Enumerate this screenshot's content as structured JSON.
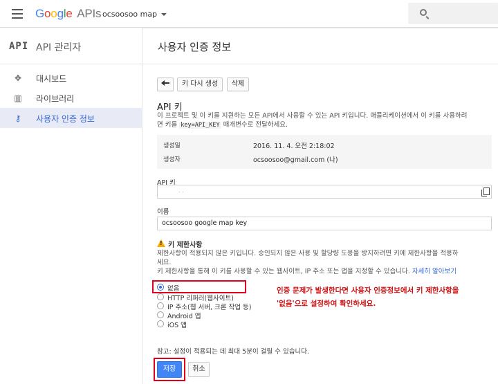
{
  "topbar": {
    "logo_google": [
      "G",
      "o",
      "o",
      "g",
      "l",
      "e"
    ],
    "logo_apis": "APIs",
    "project_name": "ocsoosoo map"
  },
  "sidebar": {
    "badge": "API",
    "title": "API 관리자",
    "items": [
      {
        "label": "대시보드",
        "icon": "dashboard-icon"
      },
      {
        "label": "라이브러리",
        "icon": "library-icon"
      },
      {
        "label": "사용자 인증 정보",
        "icon": "key-icon",
        "active": true
      }
    ]
  },
  "main": {
    "page_title": "사용자 인증 정보",
    "toolbar": {
      "regenerate_label": "키 다시 생성",
      "delete_label": "삭제"
    },
    "api_key_heading": "API 키",
    "description_line1": "이 프로젝트 및 이 키를 지원하는 모든 API에서 사용할 수 있는 API 키입니다. 애플리케이션에서 이 키를 사용하려",
    "description_line2_pre": "면 키를",
    "description_code": "key=API_KEY",
    "description_line2_post": "매개변수로 전달하세요.",
    "meta": {
      "created_label": "생성일",
      "created_value": "2016. 11. 4. 오전 2:18:02",
      "creator_label": "생성자",
      "creator_value": "ocsoosoo@gmail.com (나)"
    },
    "api_key_label": "API 키",
    "api_key_value": ".                    .",
    "name_label": "이름",
    "name_value": "ocsoosoo google map key",
    "restriction": {
      "title": "키 제한사항",
      "text_line1": "제한사항이 적용되지 않은 키입니다. 승인되지 않은 사용 및 할당량 도용을 방지하려면 키에 제한사항을 적용하",
      "text_line2": "세요.",
      "text_line3": "키 제한사항을 통해 이 키를 사용할 수 있는 웹사이트, IP 주소 또는 앱을 지정할 수 있습니다.",
      "learn_more": "자세히 알아보기",
      "options": [
        {
          "label": "없음",
          "checked": true
        },
        {
          "label": "HTTP 리퍼러(웹사이트)",
          "checked": false
        },
        {
          "label": "IP 주소(웹 서버, 크론 작업 등)",
          "checked": false
        },
        {
          "label": "Android 앱",
          "checked": false
        },
        {
          "label": "iOS 앱",
          "checked": false
        }
      ]
    },
    "annotation_line1": "인증 문제가 발생한다면 사용자 인증정보에서 키 제한사항을",
    "annotation_line2": "'없음'으로 설정하여 확인하세요.",
    "note": "참고: 설정이 적용되는 데 최대 5분이 걸릴 수 있습니다.",
    "save_label": "저장",
    "cancel_label": "취소"
  },
  "colors": {
    "brand_blue": "#4285f4",
    "active_blue": "#3367d6",
    "annotation_red": "#e0001b",
    "warning": "#f9ab00"
  }
}
